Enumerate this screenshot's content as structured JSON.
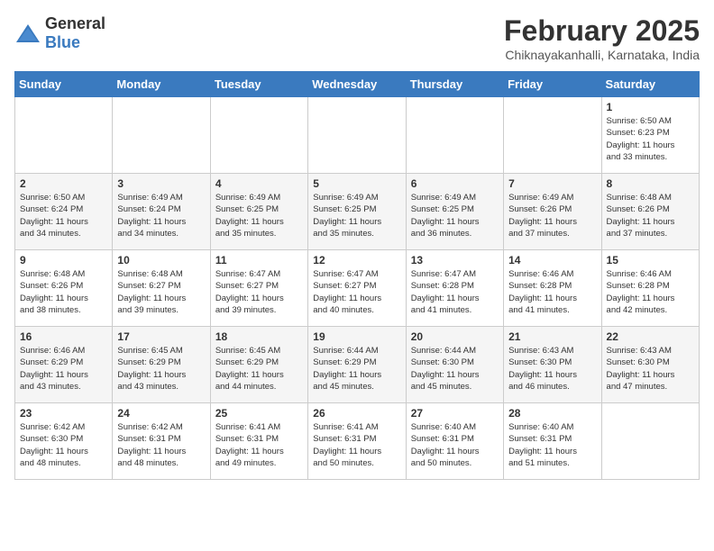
{
  "header": {
    "logo_general": "General",
    "logo_blue": "Blue",
    "title": "February 2025",
    "subtitle": "Chiknayakanhalli, Karnataka, India"
  },
  "days_of_week": [
    "Sunday",
    "Monday",
    "Tuesday",
    "Wednesday",
    "Thursday",
    "Friday",
    "Saturday"
  ],
  "weeks": [
    [
      {
        "day": "",
        "info": ""
      },
      {
        "day": "",
        "info": ""
      },
      {
        "day": "",
        "info": ""
      },
      {
        "day": "",
        "info": ""
      },
      {
        "day": "",
        "info": ""
      },
      {
        "day": "",
        "info": ""
      },
      {
        "day": "1",
        "info": "Sunrise: 6:50 AM\nSunset: 6:23 PM\nDaylight: 11 hours\nand 33 minutes."
      }
    ],
    [
      {
        "day": "2",
        "info": "Sunrise: 6:50 AM\nSunset: 6:24 PM\nDaylight: 11 hours\nand 34 minutes."
      },
      {
        "day": "3",
        "info": "Sunrise: 6:49 AM\nSunset: 6:24 PM\nDaylight: 11 hours\nand 34 minutes."
      },
      {
        "day": "4",
        "info": "Sunrise: 6:49 AM\nSunset: 6:25 PM\nDaylight: 11 hours\nand 35 minutes."
      },
      {
        "day": "5",
        "info": "Sunrise: 6:49 AM\nSunset: 6:25 PM\nDaylight: 11 hours\nand 35 minutes."
      },
      {
        "day": "6",
        "info": "Sunrise: 6:49 AM\nSunset: 6:25 PM\nDaylight: 11 hours\nand 36 minutes."
      },
      {
        "day": "7",
        "info": "Sunrise: 6:49 AM\nSunset: 6:26 PM\nDaylight: 11 hours\nand 37 minutes."
      },
      {
        "day": "8",
        "info": "Sunrise: 6:48 AM\nSunset: 6:26 PM\nDaylight: 11 hours\nand 37 minutes."
      }
    ],
    [
      {
        "day": "9",
        "info": "Sunrise: 6:48 AM\nSunset: 6:26 PM\nDaylight: 11 hours\nand 38 minutes."
      },
      {
        "day": "10",
        "info": "Sunrise: 6:48 AM\nSunset: 6:27 PM\nDaylight: 11 hours\nand 39 minutes."
      },
      {
        "day": "11",
        "info": "Sunrise: 6:47 AM\nSunset: 6:27 PM\nDaylight: 11 hours\nand 39 minutes."
      },
      {
        "day": "12",
        "info": "Sunrise: 6:47 AM\nSunset: 6:27 PM\nDaylight: 11 hours\nand 40 minutes."
      },
      {
        "day": "13",
        "info": "Sunrise: 6:47 AM\nSunset: 6:28 PM\nDaylight: 11 hours\nand 41 minutes."
      },
      {
        "day": "14",
        "info": "Sunrise: 6:46 AM\nSunset: 6:28 PM\nDaylight: 11 hours\nand 41 minutes."
      },
      {
        "day": "15",
        "info": "Sunrise: 6:46 AM\nSunset: 6:28 PM\nDaylight: 11 hours\nand 42 minutes."
      }
    ],
    [
      {
        "day": "16",
        "info": "Sunrise: 6:46 AM\nSunset: 6:29 PM\nDaylight: 11 hours\nand 43 minutes."
      },
      {
        "day": "17",
        "info": "Sunrise: 6:45 AM\nSunset: 6:29 PM\nDaylight: 11 hours\nand 43 minutes."
      },
      {
        "day": "18",
        "info": "Sunrise: 6:45 AM\nSunset: 6:29 PM\nDaylight: 11 hours\nand 44 minutes."
      },
      {
        "day": "19",
        "info": "Sunrise: 6:44 AM\nSunset: 6:29 PM\nDaylight: 11 hours\nand 45 minutes."
      },
      {
        "day": "20",
        "info": "Sunrise: 6:44 AM\nSunset: 6:30 PM\nDaylight: 11 hours\nand 45 minutes."
      },
      {
        "day": "21",
        "info": "Sunrise: 6:43 AM\nSunset: 6:30 PM\nDaylight: 11 hours\nand 46 minutes."
      },
      {
        "day": "22",
        "info": "Sunrise: 6:43 AM\nSunset: 6:30 PM\nDaylight: 11 hours\nand 47 minutes."
      }
    ],
    [
      {
        "day": "23",
        "info": "Sunrise: 6:42 AM\nSunset: 6:30 PM\nDaylight: 11 hours\nand 48 minutes."
      },
      {
        "day": "24",
        "info": "Sunrise: 6:42 AM\nSunset: 6:31 PM\nDaylight: 11 hours\nand 48 minutes."
      },
      {
        "day": "25",
        "info": "Sunrise: 6:41 AM\nSunset: 6:31 PM\nDaylight: 11 hours\nand 49 minutes."
      },
      {
        "day": "26",
        "info": "Sunrise: 6:41 AM\nSunset: 6:31 PM\nDaylight: 11 hours\nand 50 minutes."
      },
      {
        "day": "27",
        "info": "Sunrise: 6:40 AM\nSunset: 6:31 PM\nDaylight: 11 hours\nand 50 minutes."
      },
      {
        "day": "28",
        "info": "Sunrise: 6:40 AM\nSunset: 6:31 PM\nDaylight: 11 hours\nand 51 minutes."
      },
      {
        "day": "",
        "info": ""
      }
    ]
  ]
}
